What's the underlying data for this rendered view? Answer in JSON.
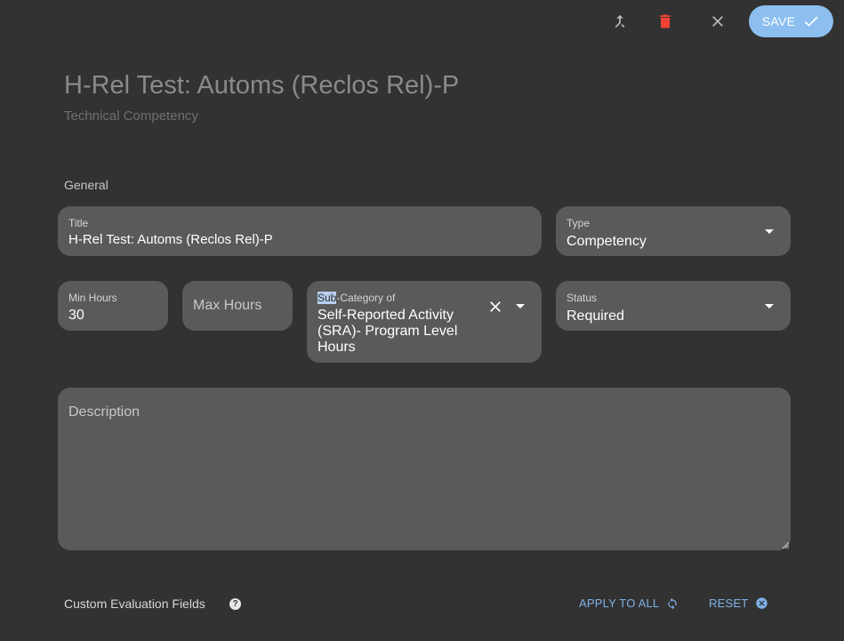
{
  "toolbar": {
    "merge_icon": "merge-icon",
    "delete_icon": "trash-icon",
    "close_icon": "close-icon",
    "save_label": "SAVE",
    "delete_color": "#f44336",
    "save_color": "#8cbff0"
  },
  "header": {
    "title": "H-Rel Test: Automs (Reclos Rel)-P",
    "subtitle": "Technical Competency"
  },
  "general": {
    "section_label": "General",
    "title_field": {
      "label": "Title",
      "value": "H-Rel Test: Automs (Reclos Rel)-P"
    },
    "type_field": {
      "label": "Type",
      "value": "Competency"
    },
    "min_hours": {
      "label": "Min Hours",
      "value": "30"
    },
    "max_hours": {
      "placeholder": "Max Hours"
    },
    "sub_category": {
      "label_highlight": "Sub",
      "label_rest": "-Category of",
      "value": "Self-Reported Activity (SRA)- Program Level Hours"
    },
    "status_field": {
      "label": "Status",
      "value": "Required"
    },
    "description": {
      "placeholder": "Description"
    }
  },
  "custom_fields": {
    "label": "Custom Evaluation Fields",
    "help_icon": "?",
    "apply_all_label": "APPLY TO ALL",
    "reset_label": "RESET"
  }
}
